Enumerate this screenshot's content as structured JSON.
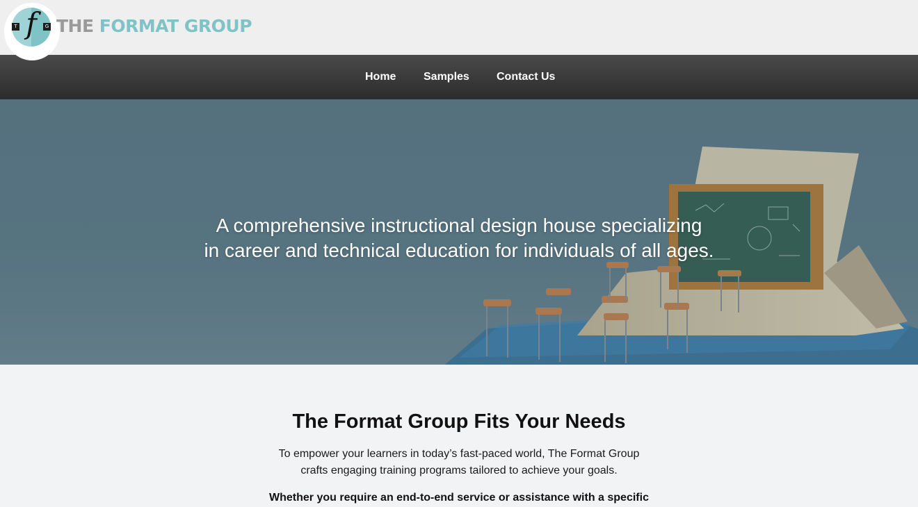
{
  "header": {
    "logo_letter": "f",
    "logo_left_tile": "T",
    "logo_right_tile": "G",
    "brand_word_1": "THE",
    "brand_word_2": "FORMAT GROUP"
  },
  "nav": {
    "items": [
      {
        "label": "Home"
      },
      {
        "label": "Samples"
      },
      {
        "label": "Contact Us"
      }
    ]
  },
  "hero": {
    "line_1": "A comprehensive instructional design house specializing",
    "line_2": "in career and technical education for individuals of all ages."
  },
  "intro": {
    "title": "The Format Group Fits Your Needs",
    "line_1": "To empower your learners in today’s fast-paced world, The Format Group",
    "line_2": "crafts engaging training programs tailored to achieve your goals.",
    "bold_line": "Whether you require an end-to-end service or assistance with a specific"
  },
  "colors": {
    "accent_teal": "#7fc3c7",
    "brand_gray": "#9a9a9a",
    "nav_bg": "#333333",
    "hero_bg": "#597482",
    "page_bg": "#f2f3f5"
  },
  "icons": [
    "logo-f-mark"
  ]
}
